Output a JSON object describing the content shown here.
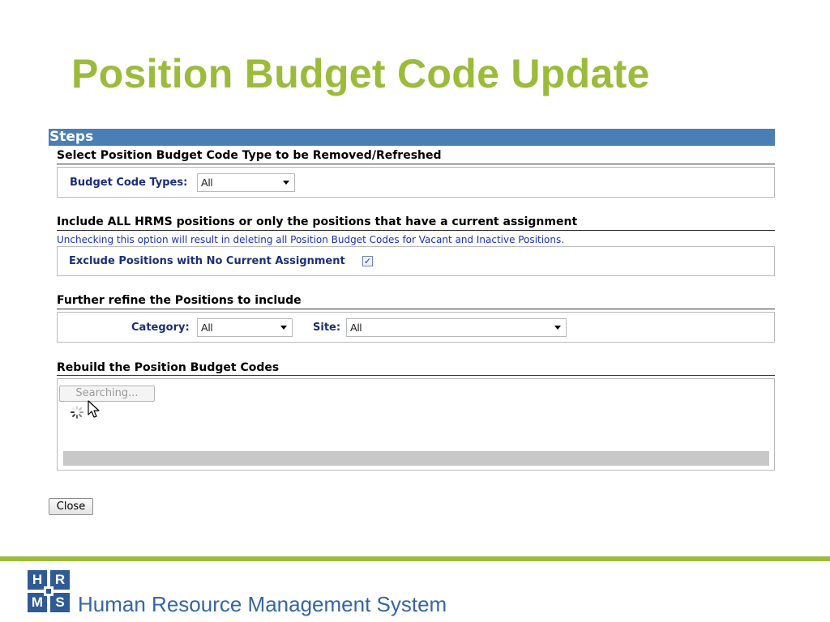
{
  "slide": {
    "title": "Position Budget Code Update"
  },
  "steps": {
    "header": "Steps",
    "section1": {
      "title": "Select Position Budget Code Type to be Removed/Refreshed",
      "budget_code_types_label": "Budget Code Types:",
      "budget_code_types_value": "All"
    },
    "section2": {
      "title": "Include ALL HRMS positions or only the positions that have a current assignment",
      "note": "Unchecking this option will result in deleting all Position Budget Codes for Vacant and Inactive Positions.",
      "exclude_label": "Exclude Positions with No Current Assignment",
      "exclude_checked": true,
      "check_glyph": "✓"
    },
    "section3": {
      "title": "Further refine the Positions to include",
      "category_label": "Category:",
      "category_value": "All",
      "site_label": "Site:",
      "site_value": "All"
    },
    "section4": {
      "title": "Rebuild the Position Budget Codes",
      "searching_button": "Searching..."
    }
  },
  "close_button": "Close",
  "footer": {
    "logo_letters": [
      "H",
      "R",
      "M",
      "S"
    ],
    "text": "Human Resource Management System"
  },
  "colors": {
    "title_green": "#9bbb3a",
    "steps_blue": "#4a7fb5",
    "label_navy": "#1b2e7a",
    "note_blue": "#1a33b0",
    "logo_blue": "#2e5b94"
  },
  "icons": {
    "spinner": "loading-spinner-icon",
    "cursor": "mouse-pointer-icon",
    "caret": "chevron-down-icon"
  }
}
